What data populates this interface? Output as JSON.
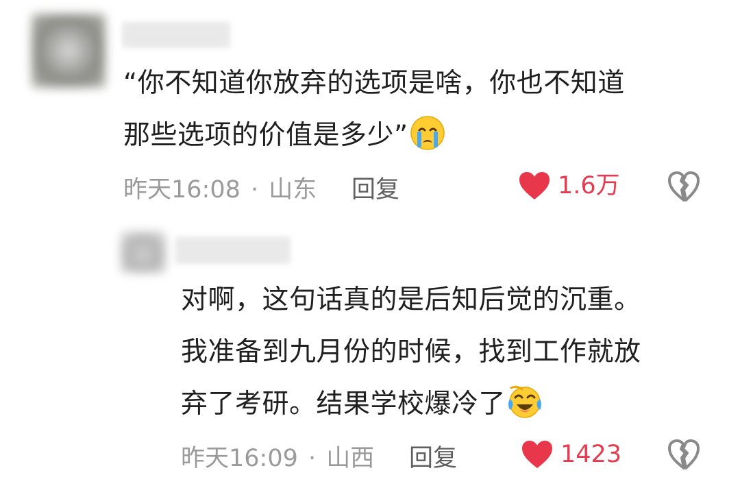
{
  "comments": [
    {
      "lines": [
        "“你不知道你放弃的选项是啥，你也不知道",
        "那些选项的价值是多少”"
      ],
      "emoji": "crying-face-icon",
      "time": "昨天16:08",
      "separator": "·",
      "location": "山东",
      "reply_label": "回复",
      "likes": "1.6万"
    },
    {
      "lines": [
        "对啊，这句话真的是后知后觉的沉重。",
        "我准备到九月份的时候，找到工作就放",
        "弃了考研。结果学校爆冷了"
      ],
      "emoji": "laughing-crying-face-icon",
      "time": "昨天16:09",
      "separator": "·",
      "location": "山西",
      "reply_label": "回复",
      "likes": "1423"
    }
  ],
  "colors": {
    "like": "#e53b4f",
    "meta": "#9a9a9a",
    "text": "#1f1f1f"
  },
  "icons": {
    "like": "heart-icon",
    "dislike": "broken-heart-icon"
  }
}
